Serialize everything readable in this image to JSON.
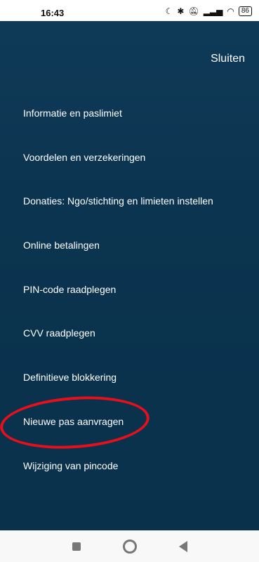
{
  "status": {
    "time": "16:43",
    "battery": "86"
  },
  "header": {
    "close_label": "Sluiten"
  },
  "menu": {
    "items": [
      "Informatie en paslimiet",
      "Voordelen en verzekeringen",
      "Donaties: Ngo/stichting en limieten instellen",
      "Online betalingen",
      "PIN-code raadplegen",
      "CVV raadplegen",
      "Definitieve blokkering",
      "Nieuwe pas aanvragen",
      "Wijziging van pincode"
    ]
  },
  "colors": {
    "panel": "#0b3450",
    "highlight": "#e5101c"
  }
}
